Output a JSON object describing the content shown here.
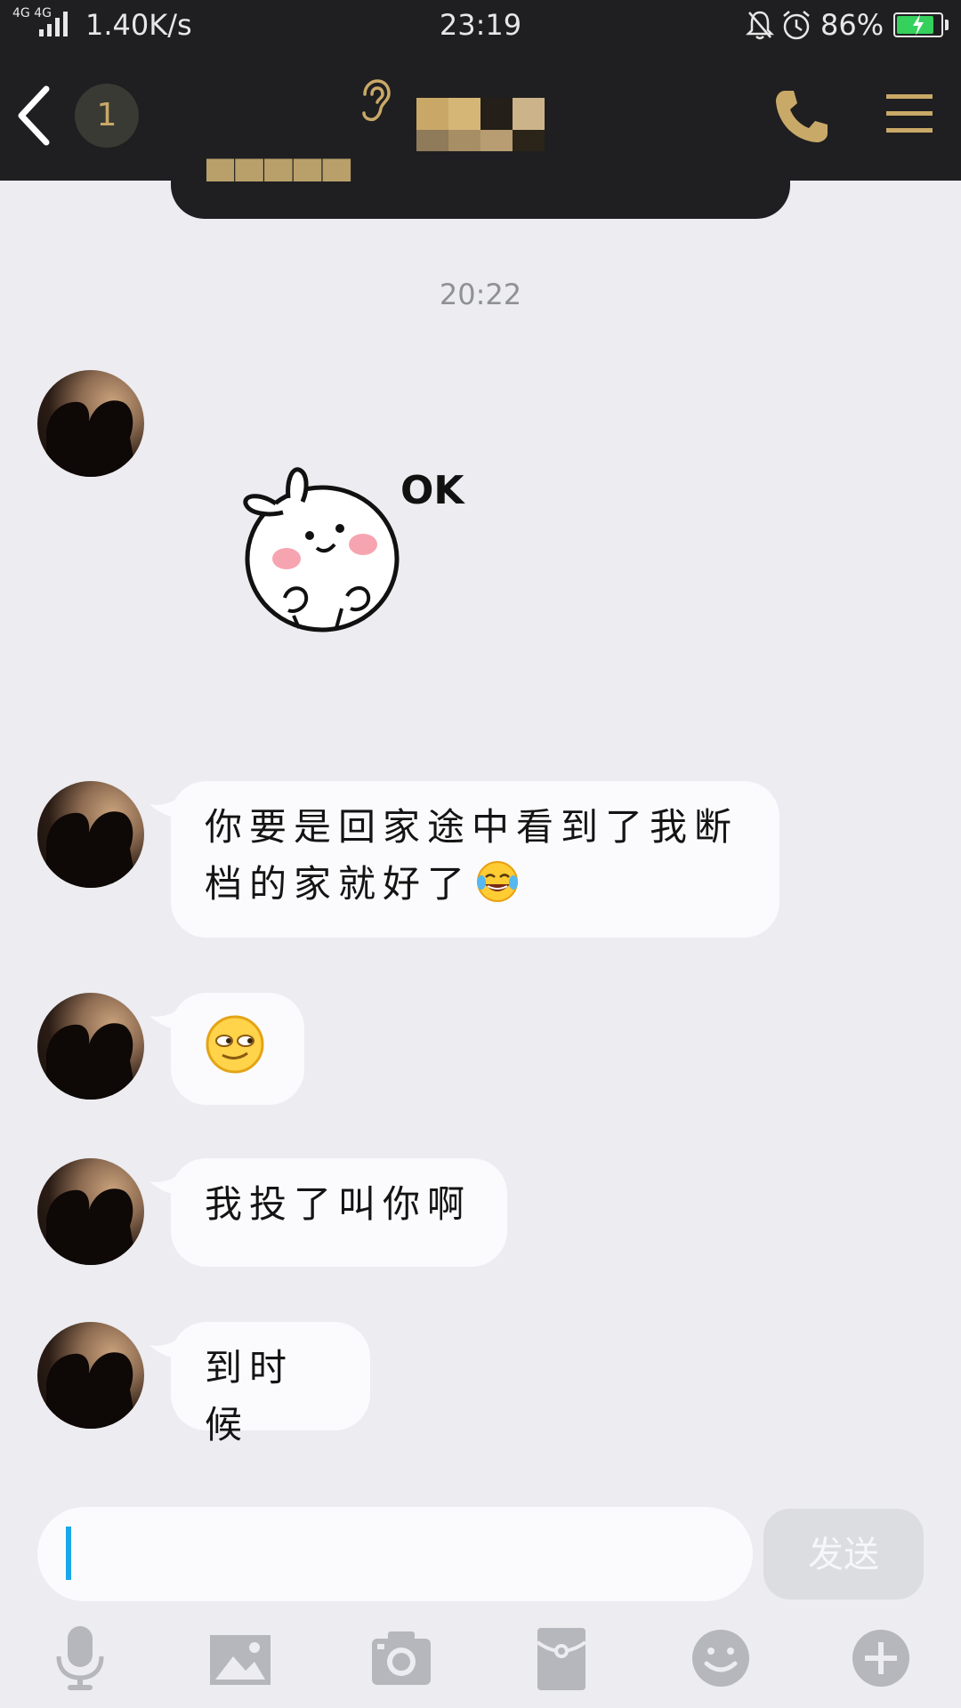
{
  "status_bar": {
    "network": "4G 4G",
    "speed": "1.40K/s",
    "time": "23:19",
    "battery_percent": "86%",
    "battery_level": 0.86,
    "battery_color": "#35d15c"
  },
  "header": {
    "unread_count": "1",
    "accent_color": "#c9a968"
  },
  "chat": {
    "timestamp": "20:22",
    "messages": [
      {
        "type": "sticker",
        "sticker_text": "OK"
      },
      {
        "type": "text",
        "line1": "你要是回家途中看到了我断",
        "line2": "档的家就好了",
        "emoji": "tears-of-joy"
      },
      {
        "type": "emoji",
        "emoji": "smirk"
      },
      {
        "type": "text",
        "text": "我投了叫你啊"
      },
      {
        "type": "text",
        "text": "到时候"
      }
    ]
  },
  "input_bar": {
    "placeholder": "",
    "value": "",
    "send_label": "发送"
  },
  "toolbar": {
    "icons": [
      "microphone-icon",
      "image-icon",
      "camera-icon",
      "red-packet-icon",
      "emoji-icon",
      "plus-icon"
    ]
  }
}
